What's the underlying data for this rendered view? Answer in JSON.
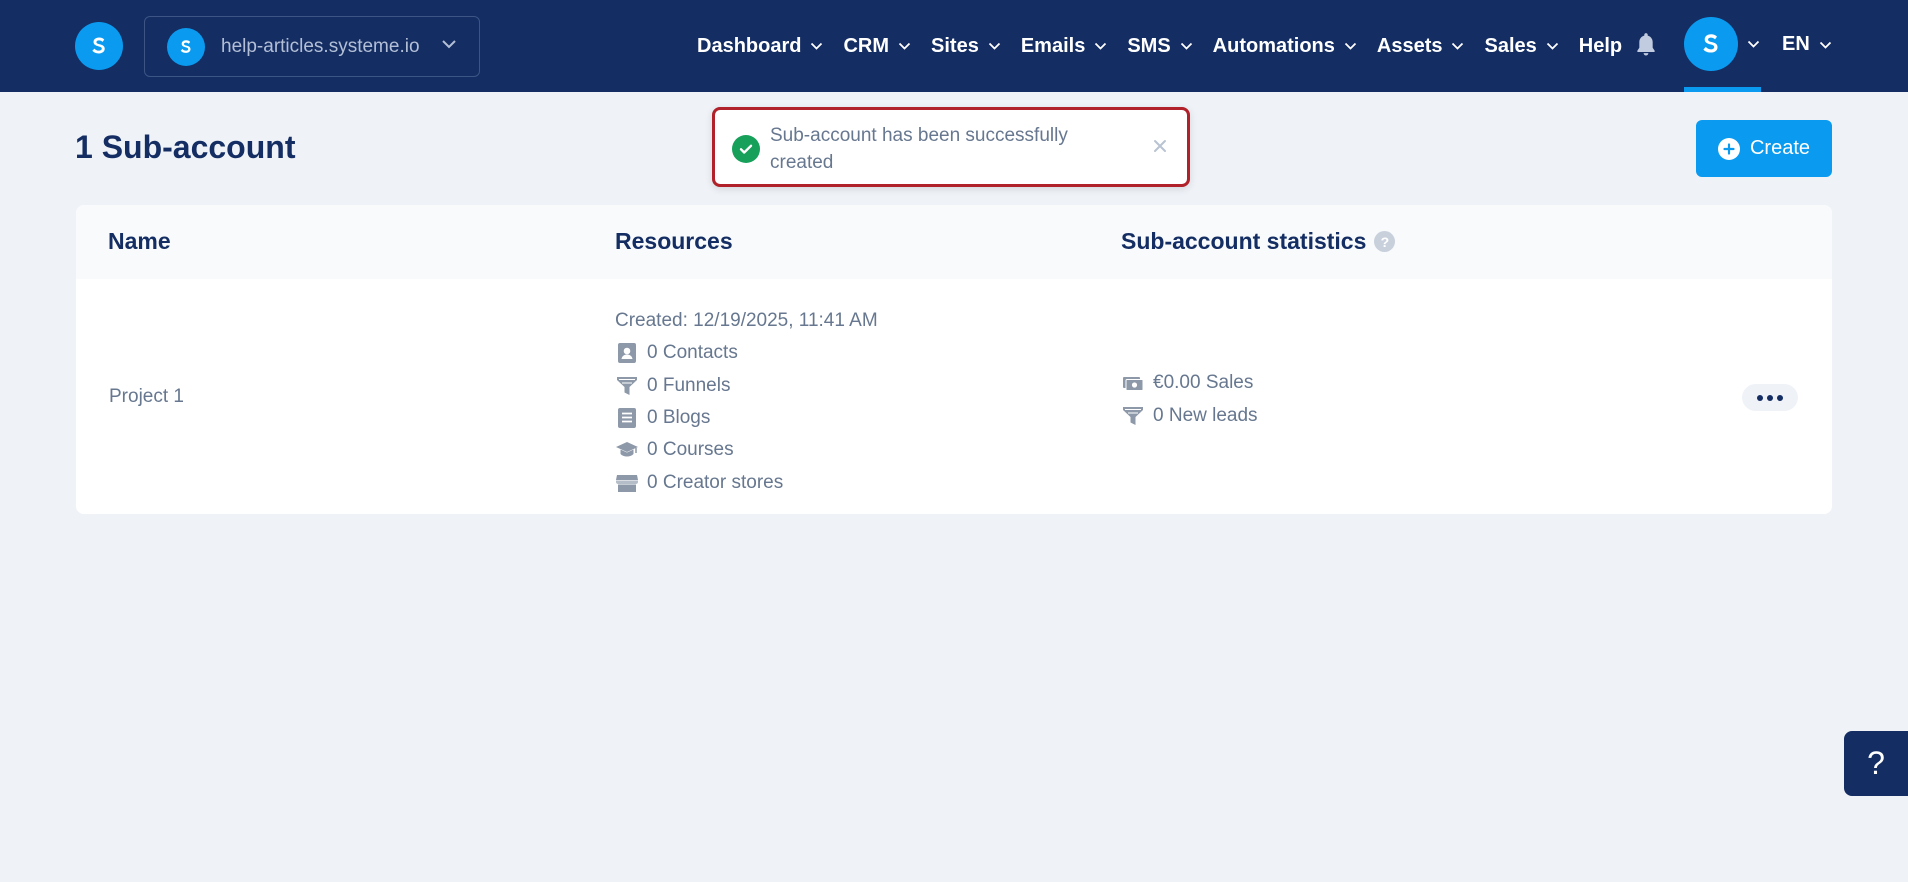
{
  "workspace": {
    "name": "help-articles.systeme.io"
  },
  "nav": {
    "items": [
      {
        "label": "Dashboard",
        "has_menu": true
      },
      {
        "label": "CRM",
        "has_menu": true
      },
      {
        "label": "Sites",
        "has_menu": true
      },
      {
        "label": "Emails",
        "has_menu": true
      },
      {
        "label": "SMS",
        "has_menu": true
      },
      {
        "label": "Automations",
        "has_menu": true
      },
      {
        "label": "Assets",
        "has_menu": true
      },
      {
        "label": "Sales",
        "has_menu": true
      },
      {
        "label": "Help",
        "has_menu": false
      }
    ],
    "language": "EN"
  },
  "page": {
    "title": "1 Sub-account"
  },
  "toast": {
    "message": "Sub-account has been successfully created"
  },
  "create_button": {
    "label": "Create"
  },
  "table": {
    "headers": {
      "name": "Name",
      "resources": "Resources",
      "statistics": "Sub-account statistics"
    },
    "rows": [
      {
        "name": "Project 1",
        "created": "Created: 12/19/2025, 11:41 AM",
        "resources": [
          {
            "icon": "contact-icon",
            "text": "0 Contacts"
          },
          {
            "icon": "funnel-icon",
            "text": "0 Funnels"
          },
          {
            "icon": "blog-icon",
            "text": "0 Blogs"
          },
          {
            "icon": "course-icon",
            "text": "0 Courses"
          },
          {
            "icon": "store-icon",
            "text": "0 Creator stores"
          }
        ],
        "statistics": [
          {
            "icon": "money-icon",
            "text": "€0.00 Sales"
          },
          {
            "icon": "funnel-icon",
            "text": "0 New leads"
          }
        ]
      }
    ]
  },
  "help_fab": {
    "label": "?"
  },
  "colors": {
    "nav_bg": "#142d63",
    "brand_blue": "#0a9bf0",
    "success": "#16a05a",
    "highlight_border": "#b0212a"
  }
}
